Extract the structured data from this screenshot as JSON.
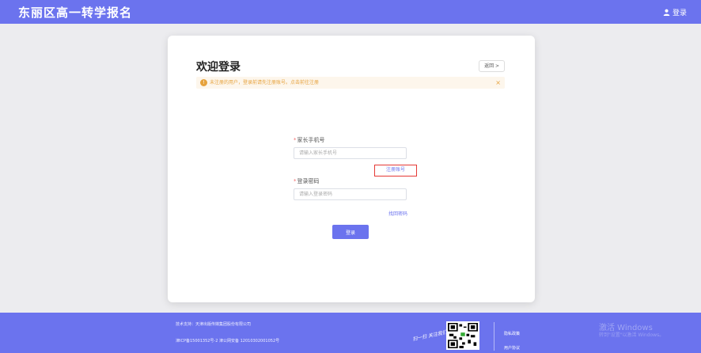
{
  "header": {
    "title": "东丽区高一转学报名",
    "login_label": "登录"
  },
  "card": {
    "title": "欢迎登录",
    "back_label": "返回 >",
    "notice_text": "未注册的用户，登录前请先注册账号。点击前往注册",
    "notice_close": "×",
    "phone_label": "家长手机号",
    "phone_placeholder": "请输入家长手机号",
    "register_link": "注册账号",
    "password_label": "登录密码",
    "password_placeholder": "请输入登录密码",
    "forgot_link": "找回密码",
    "submit_label": "登录"
  },
  "footer": {
    "support": "技术支持：天津出版传媒集团股份有限公司",
    "icp": "津ICP备15001352号-2 津公网安备 12010302001052号",
    "slogan": "扫一扫 关注我们",
    "side_link_1": "隐私政策",
    "side_link_2": "用户协议",
    "watermark_title": "激活 Windows",
    "watermark_sub": "转到\"设置\"以激活 Windows。"
  },
  "colors": {
    "brand": "#6b73ee",
    "warning": "#e6a23c",
    "highlight": "#e53935"
  }
}
